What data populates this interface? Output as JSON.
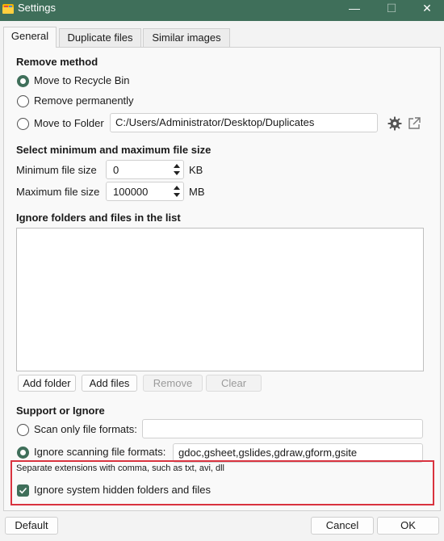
{
  "window": {
    "title": "Settings",
    "accent_color": "#3f6f5a",
    "highlight_color": "#d9333f",
    "controls": {
      "minimize": "—",
      "maximize": "☐",
      "close": "✕"
    }
  },
  "tabs": [
    {
      "label": "General",
      "active": true
    },
    {
      "label": "Duplicate files",
      "active": false
    },
    {
      "label": "Similar images",
      "active": false
    }
  ],
  "remove_method": {
    "heading": "Remove method",
    "options": [
      {
        "label": "Move to Recycle Bin",
        "checked": true
      },
      {
        "label": "Remove permanently",
        "checked": false
      },
      {
        "label": "Move to Folder",
        "checked": false
      }
    ],
    "folder_path": "C:/Users/Administrator/Desktop/Duplicates",
    "settings_icon": "gear-icon",
    "open_icon": "open-external-icon"
  },
  "file_size": {
    "heading": "Select minimum and maximum file size",
    "min_label": "Minimum file size",
    "min_value": "0",
    "min_unit": "KB",
    "max_label": "Maximum file size",
    "max_value": "100000",
    "max_unit": "MB"
  },
  "ignore_list": {
    "heading": "Ignore folders and files in the list",
    "items": [],
    "buttons": {
      "add_folder": "Add folder",
      "add_files": "Add files",
      "remove": "Remove",
      "clear": "Clear"
    }
  },
  "support": {
    "heading": "Support or Ignore",
    "scan_only_label": "Scan only file formats:",
    "scan_only_value": "",
    "ignore_label": "Ignore scanning file formats:",
    "ignore_value": "gdoc,gsheet,gslides,gdraw,gform,gsite",
    "ignore_hint": "Separate extensions with comma, such as txt, avi, dll",
    "hidden_label": "Ignore system hidden folders and files",
    "hidden_checked": true
  },
  "footer": {
    "default": "Default",
    "cancel": "Cancel",
    "ok": "OK"
  }
}
